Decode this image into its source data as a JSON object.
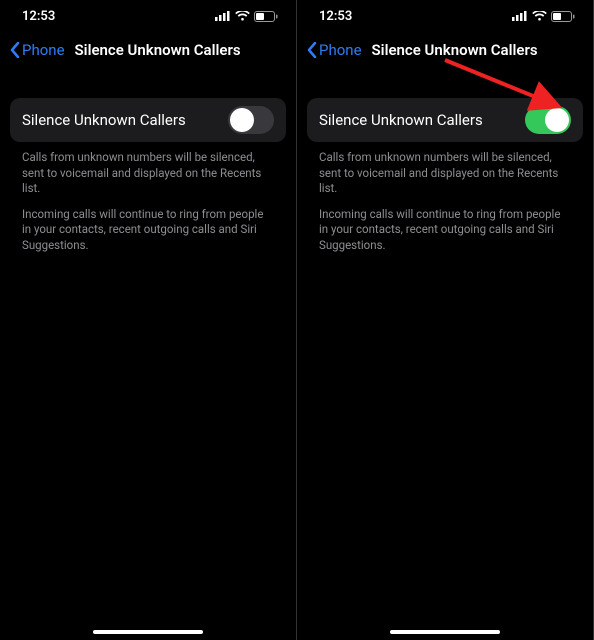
{
  "status": {
    "time": "12:53"
  },
  "nav": {
    "back_label": "Phone",
    "title": "Silence Unknown Callers"
  },
  "cell": {
    "label": "Silence Unknown Callers"
  },
  "footer": {
    "p1": "Calls from unknown numbers will be silenced, sent to voicemail and displayed on the Recents list.",
    "p2": "Incoming calls will continue to ring from people in your contacts, recent outgoing calls and Siri Suggestions."
  },
  "screens": {
    "left": {
      "toggle_on": false
    },
    "right": {
      "toggle_on": true
    }
  }
}
